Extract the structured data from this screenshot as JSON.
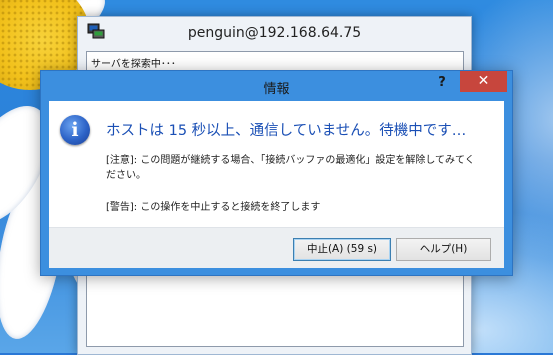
{
  "background_window": {
    "title": "penguin@192.168.64.75",
    "status_text": "サーバを探索中･･･"
  },
  "dialog": {
    "title": "情報",
    "help_glyph": "?",
    "close_glyph": "✕",
    "icon": "info-icon",
    "main_instruction": "ホストは 15 秒以上、通信していません。待機中です…",
    "note": "[注意]: この問題が継続する場合、「接続バッファの最適化」設定を解除してみてください。",
    "warning": "[警告]: この操作を中止すると接続を終了します",
    "buttons": {
      "abort": "中止(A) (59 s)",
      "help": "ヘルプ(H)"
    }
  },
  "colors": {
    "titlebar_accent": "#3c8fdf",
    "close_button": "#c7463d",
    "instruction_text": "#1a4fb5"
  }
}
